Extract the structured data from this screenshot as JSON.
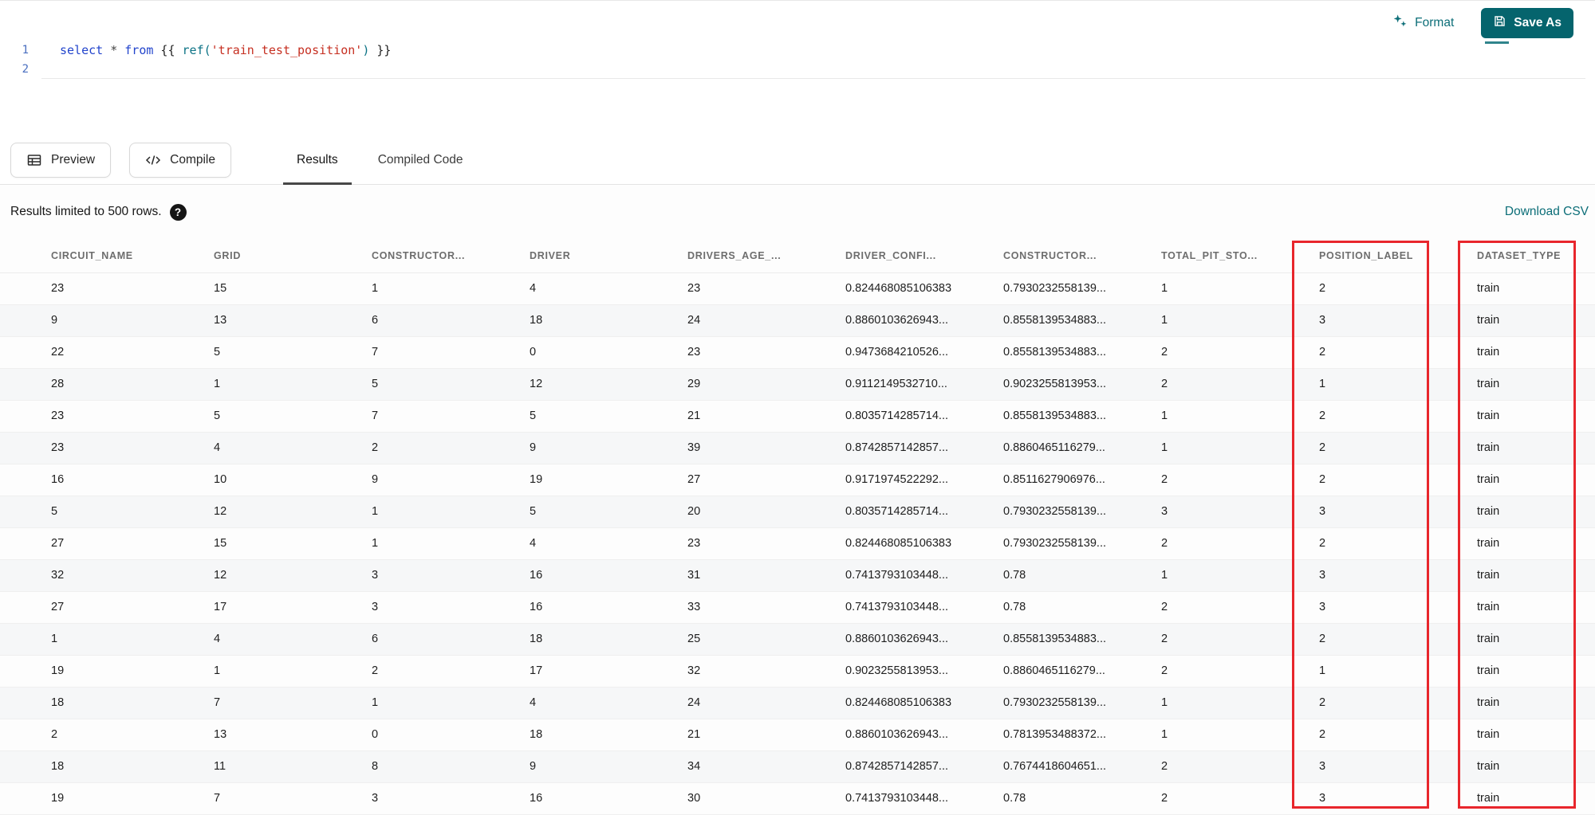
{
  "topbar": {
    "format_label": "Format",
    "save_as_label": "Save As"
  },
  "editor": {
    "lines": [
      {
        "number": "1"
      },
      {
        "number": "2"
      }
    ],
    "code_tokens": [
      {
        "text": "select",
        "type": "keyword"
      },
      {
        "text": " ",
        "type": "plain"
      },
      {
        "text": "*",
        "type": "operator"
      },
      {
        "text": " ",
        "type": "plain"
      },
      {
        "text": "from",
        "type": "keyword"
      },
      {
        "text": " {{ ",
        "type": "plain"
      },
      {
        "text": "ref(",
        "type": "function"
      },
      {
        "text": "'train_test_position'",
        "type": "string"
      },
      {
        "text": ")",
        "type": "function"
      },
      {
        "text": " }}",
        "type": "plain"
      }
    ]
  },
  "toolbar": {
    "preview_label": "Preview",
    "compile_label": "Compile",
    "tabs": [
      {
        "label": "Results",
        "active": true
      },
      {
        "label": "Compiled Code",
        "active": false
      }
    ]
  },
  "results": {
    "limit_text": "Results limited to 500 rows.",
    "help_icon": "?",
    "download_label": "Download CSV",
    "table": {
      "columns": [
        "CIRCUIT_NAME",
        "GRID",
        "CONSTRUCTOR...",
        "DRIVER",
        "DRIVERS_AGE_...",
        "DRIVER_CONFI...",
        "CONSTRUCTOR...",
        "TOTAL_PIT_STO...",
        "POSITION_LABEL",
        "DATASET_TYPE"
      ],
      "rows": [
        [
          "23",
          "15",
          "1",
          "4",
          "23",
          "0.824468085106383",
          "0.7930232558139...",
          "1",
          "2",
          "train"
        ],
        [
          "9",
          "13",
          "6",
          "18",
          "24",
          "0.8860103626943...",
          "0.8558139534883...",
          "1",
          "3",
          "train"
        ],
        [
          "22",
          "5",
          "7",
          "0",
          "23",
          "0.9473684210526...",
          "0.8558139534883...",
          "2",
          "2",
          "train"
        ],
        [
          "28",
          "1",
          "5",
          "12",
          "29",
          "0.9112149532710...",
          "0.9023255813953...",
          "2",
          "1",
          "train"
        ],
        [
          "23",
          "5",
          "7",
          "5",
          "21",
          "0.8035714285714...",
          "0.8558139534883...",
          "1",
          "2",
          "train"
        ],
        [
          "23",
          "4",
          "2",
          "9",
          "39",
          "0.8742857142857...",
          "0.8860465116279...",
          "1",
          "2",
          "train"
        ],
        [
          "16",
          "10",
          "9",
          "19",
          "27",
          "0.9171974522292...",
          "0.8511627906976...",
          "2",
          "2",
          "train"
        ],
        [
          "5",
          "12",
          "1",
          "5",
          "20",
          "0.8035714285714...",
          "0.7930232558139...",
          "3",
          "3",
          "train"
        ],
        [
          "27",
          "15",
          "1",
          "4",
          "23",
          "0.824468085106383",
          "0.7930232558139...",
          "2",
          "2",
          "train"
        ],
        [
          "32",
          "12",
          "3",
          "16",
          "31",
          "0.7413793103448...",
          "0.78",
          "1",
          "3",
          "train"
        ],
        [
          "27",
          "17",
          "3",
          "16",
          "33",
          "0.7413793103448...",
          "0.78",
          "2",
          "3",
          "train"
        ],
        [
          "1",
          "4",
          "6",
          "18",
          "25",
          "0.8860103626943...",
          "0.8558139534883...",
          "2",
          "2",
          "train"
        ],
        [
          "19",
          "1",
          "2",
          "17",
          "32",
          "0.9023255813953...",
          "0.8860465116279...",
          "2",
          "1",
          "train"
        ],
        [
          "18",
          "7",
          "1",
          "4",
          "24",
          "0.824468085106383",
          "0.7930232558139...",
          "1",
          "2",
          "train"
        ],
        [
          "2",
          "13",
          "0",
          "18",
          "21",
          "0.8860103626943...",
          "0.7813953488372...",
          "1",
          "2",
          "train"
        ],
        [
          "18",
          "11",
          "8",
          "9",
          "34",
          "0.8742857142857...",
          "0.7674418604651...",
          "2",
          "3",
          "train"
        ],
        [
          "19",
          "7",
          "3",
          "16",
          "30",
          "0.7413793103448...",
          "0.78",
          "2",
          "3",
          "train"
        ]
      ]
    },
    "annotations": {
      "highlighted_columns": [
        "POSITION_LABEL",
        "DATASET_TYPE"
      ],
      "highlight_color": "#e8262c"
    }
  },
  "icons": {
    "format": "sparkles-icon",
    "save_as": "save-icon",
    "preview": "table-grid-icon",
    "compile": "code-icon",
    "help": "question-circle-icon"
  },
  "colors": {
    "accent_teal": "#0c6e78",
    "save_button_bg": "#05646d",
    "annotation_red": "#e8262c",
    "keyword_blue": "#2244cc",
    "string_red": "#c62f21",
    "function_teal": "#0b7285",
    "line_number_blue": "#4a6fc0"
  }
}
